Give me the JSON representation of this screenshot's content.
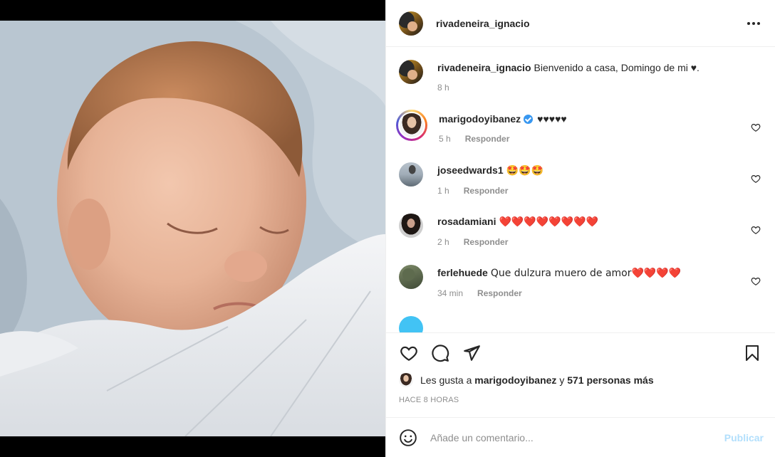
{
  "post": {
    "author": "rivadeneira_ignacio",
    "caption": "Bienvenido a casa, Domingo de mi ♥.",
    "caption_time": "8 h"
  },
  "comments": [
    {
      "user": "marigodoyibanez",
      "verified": true,
      "text": "♥♥♥♥♥",
      "time": "5 h",
      "reply": "Responder"
    },
    {
      "user": "joseedwards1",
      "text": "🤩🤩🤩",
      "time": "1 h",
      "reply": "Responder"
    },
    {
      "user": "rosadamiani",
      "text": "❤️❤️❤️❤️❤️❤️❤️❤️",
      "time": "2 h",
      "reply": "Responder"
    },
    {
      "user": "ferlehuede",
      "text": "Que dulzura muero de amor❤️❤️❤️❤️",
      "time": "34 min",
      "reply": "Responder"
    }
  ],
  "likes": {
    "prefix": "Les gusta a",
    "user": "marigodoyibanez",
    "conj": "y",
    "others": "571 personas más"
  },
  "timestamp": "HACE 8 HORAS",
  "composer": {
    "placeholder": "Añade un comentario...",
    "publish": "Publicar"
  },
  "icons": [
    "more-options-icon",
    "heart-icon",
    "comment-icon",
    "share-icon",
    "bookmark-icon",
    "emoji-icon",
    "verified-icon"
  ],
  "colors": {
    "accent": "#3897f0",
    "publish_disabled": "#b2dffc",
    "text": "#262626",
    "secondary": "#8e8e8e"
  }
}
